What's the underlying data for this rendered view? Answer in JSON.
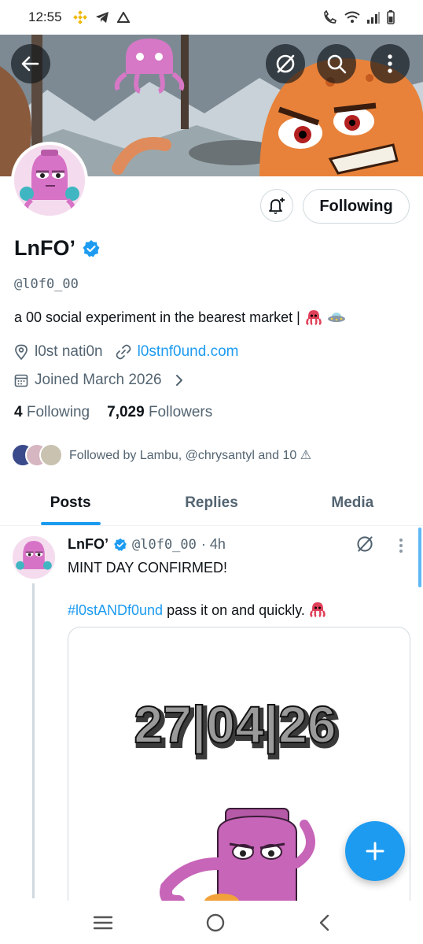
{
  "status_bar": {
    "time": "12:55"
  },
  "profile": {
    "display_name": "LnFO’",
    "handle": "@l0f0_00",
    "bio": "a 00 social experiment in the bearest market |",
    "location": "l0st nati0n",
    "website": "l0stnf0und.com",
    "joined": "Joined March 2026",
    "following_count": "4",
    "following_label": "Following",
    "followers_count": "7,029",
    "followers_label": "Followers",
    "followed_by": "Followed by Lambu, @chrysantyl and 10 ⚠"
  },
  "actions": {
    "following_button": "Following"
  },
  "tabs": [
    {
      "label": "Posts"
    },
    {
      "label": "Replies"
    },
    {
      "label": "Media"
    }
  ],
  "tweet": {
    "name": "LnFO’",
    "handle": "@l0f0_00",
    "time": "· 4h",
    "text": "MINT DAY CONFIRMED!",
    "hashtag": "#l0stANDf0und",
    "text_after": "pass it on and quickly.",
    "media_date": "27|04|26"
  },
  "colors": {
    "accent": "#1d9bf0",
    "text": "#0f1419",
    "secondary": "#536471"
  },
  "icons": {
    "back": "arrow-left-icon",
    "nostr": "slashed-circle-icon",
    "search": "search-icon",
    "more": "more-vert-icon",
    "bell": "bell-plus-icon",
    "verified": "verified-badge-icon",
    "location": "location-pin-icon",
    "link": "link-icon",
    "calendar": "calendar-icon",
    "compose": "plus-icon"
  }
}
